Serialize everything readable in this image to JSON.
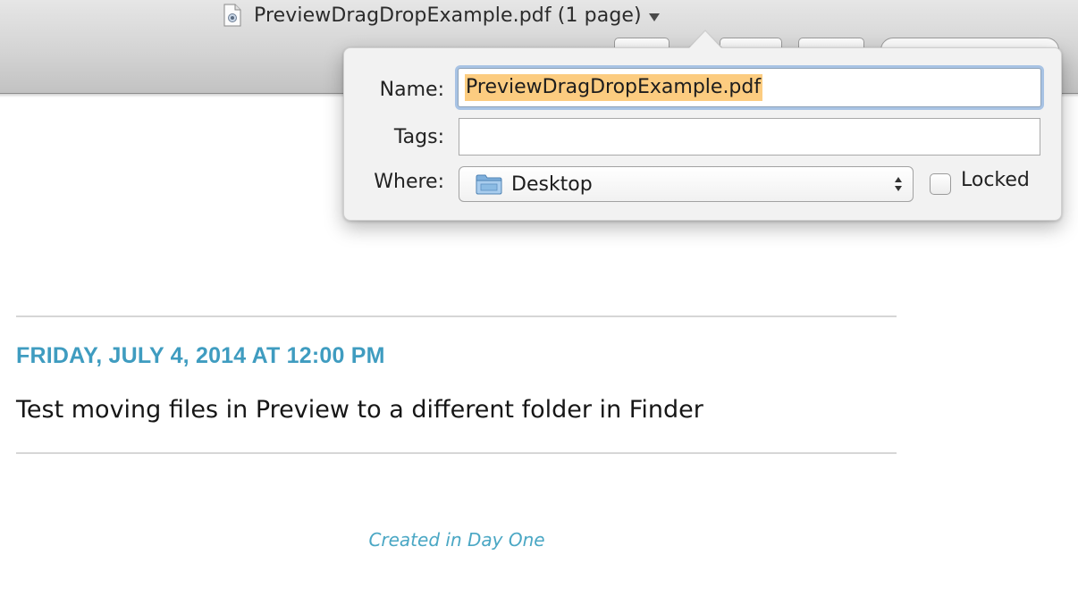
{
  "window": {
    "title": "PreviewDragDropExample.pdf (1 page)",
    "document_icon": "pdf-document-icon",
    "title_menu_icon": "chevron-down-icon"
  },
  "save_popover": {
    "name_label": "Name:",
    "name_value": "PreviewDragDropExample.pdf",
    "tags_label": "Tags:",
    "tags_value": "",
    "where_label": "Where:",
    "where_value": "Desktop",
    "where_icon": "folder-icon",
    "locked_label": "Locked",
    "locked_checked": false
  },
  "entry": {
    "date": "FRIDAY, JULY 4, 2014 AT 12:00 PM",
    "text": "Test moving files in Preview to a different folder in Finder"
  },
  "footer": {
    "text": "Created in Day One"
  },
  "colors": {
    "accent": "#3f9cc0",
    "selection": "#fccc80",
    "focus_ring": "#a8c3e4"
  }
}
